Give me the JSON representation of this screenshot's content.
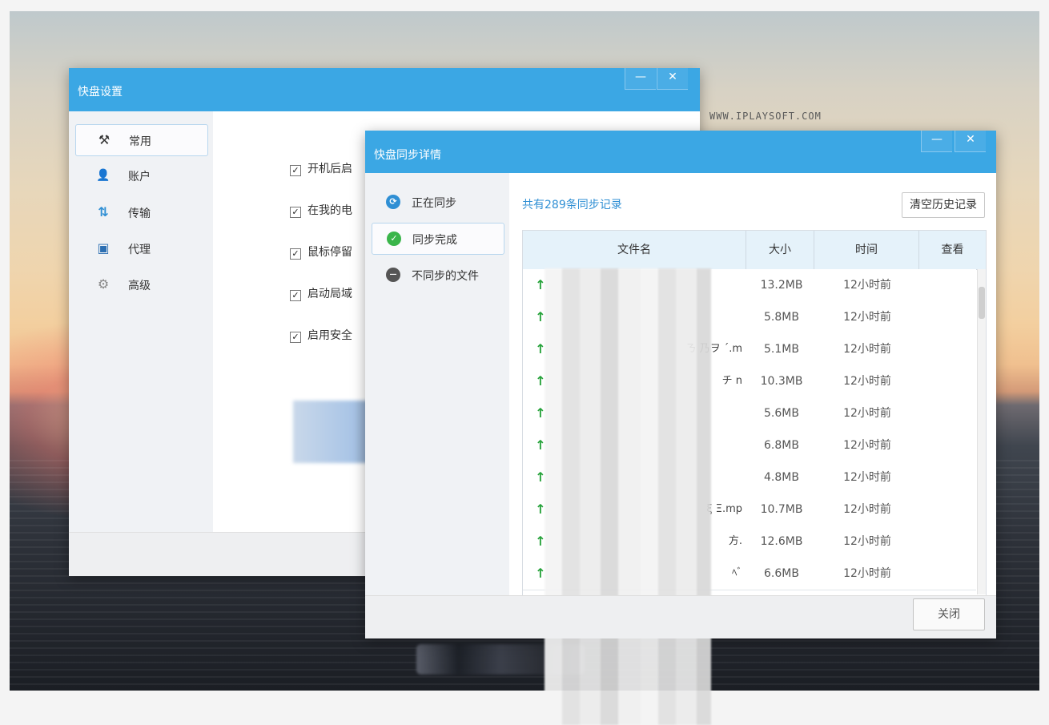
{
  "desktop": {
    "watermark": "WWW.IPLAYSOFT.COM"
  },
  "settings_window": {
    "title": "快盘设置",
    "minimize": "—",
    "close": "✕",
    "sidebar": [
      {
        "label": "常用",
        "icon": "tools-icon",
        "glyph": "⚒"
      },
      {
        "label": "账户",
        "icon": "user-icon",
        "glyph": "👤"
      },
      {
        "label": "传输",
        "icon": "transfer-icon",
        "glyph": "⇅"
      },
      {
        "label": "代理",
        "icon": "monitor-icon",
        "glyph": "▣"
      },
      {
        "label": "高级",
        "icon": "gear-icon",
        "glyph": "⚙"
      }
    ],
    "options": [
      {
        "label": "开机后启"
      },
      {
        "label": "在我的电"
      },
      {
        "label": "鼠标停留"
      },
      {
        "label": "启动局域"
      },
      {
        "label": "启用安全"
      }
    ],
    "check_mark": "✓"
  },
  "sync_window": {
    "title": "快盘同步详情",
    "minimize": "—",
    "close": "✕",
    "sidebar": [
      {
        "label": "正在同步",
        "icon": "syncing-icon",
        "glyph": "⟳",
        "color": "#2f8fd4"
      },
      {
        "label": "同步完成",
        "icon": "check-circle-icon",
        "glyph": "✓",
        "color": "#3ab54a"
      },
      {
        "label": "不同步的文件",
        "icon": "minus-circle-icon",
        "glyph": "—",
        "color": "#555555"
      }
    ],
    "count_text": "共有289条同步记录",
    "clear_button": "清空历史记录",
    "table": {
      "columns": [
        "文件名",
        "大小",
        "时间",
        "查看"
      ],
      "rows": [
        {
          "name": "",
          "size": "13.2MB",
          "time": "12小时前"
        },
        {
          "name": "",
          "size": "5.8MB",
          "time": "12小时前"
        },
        {
          "name": "ㄋ              乃ヲ      ˊ.m",
          "size": "5.1MB",
          "time": "12小时前"
        },
        {
          "name": "チ                 n",
          "size": "10.3MB",
          "time": "12小时前"
        },
        {
          "name": "",
          "size": "5.6MB",
          "time": "12小时前"
        },
        {
          "name": "",
          "size": "6.8MB",
          "time": "12小时前"
        },
        {
          "name": "",
          "size": "4.8MB",
          "time": "12小时前"
        },
        {
          "name": "ξ              Ξ.mp",
          "size": "10.7MB",
          "time": "12小时前"
        },
        {
          "name": "方.",
          "size": "12.6MB",
          "time": "12小时前"
        },
        {
          "name": "ﾍﾞ",
          "size": "6.6MB",
          "time": "12小时前"
        }
      ],
      "row_icon": "upload-arrow-icon",
      "row_glyph": "↑"
    },
    "close_button": "关闭"
  },
  "colors": {
    "titlebar": "#3ba7e4",
    "accent_text": "#2f8fd4",
    "upload_arrow": "#26a23a"
  }
}
